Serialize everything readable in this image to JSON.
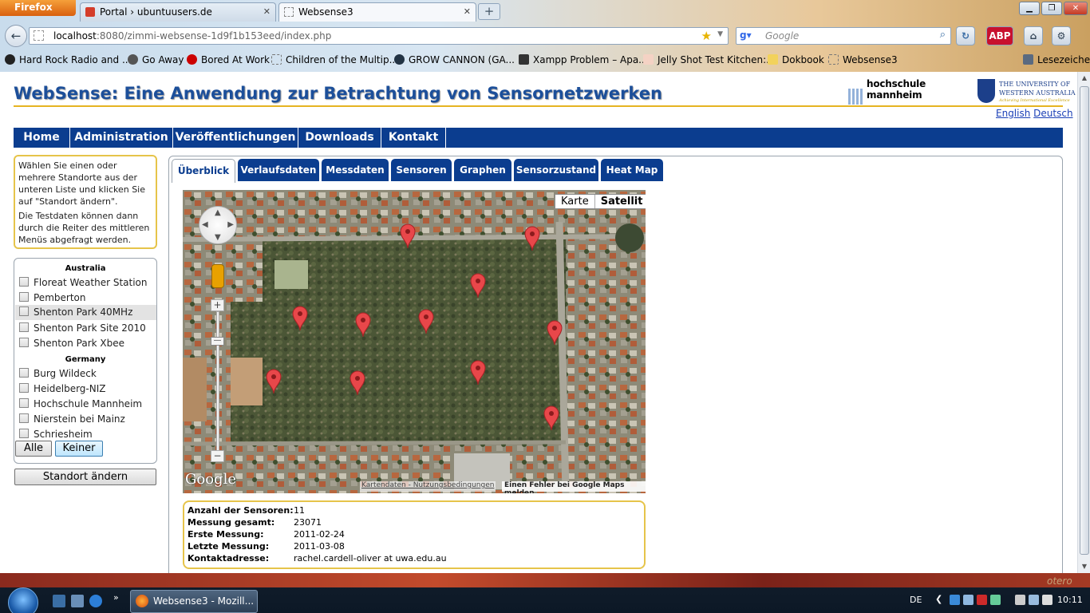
{
  "browser": {
    "app_button": "Firefox",
    "tabs": [
      {
        "label": "Portal › ubuntuusers.de"
      },
      {
        "label": "Websense3"
      }
    ],
    "url_host": "localhost",
    "url_rest": ":8080/zimmi-websense-1d9f1b153eed/index.php",
    "search_placeholder": "Google",
    "bookmarks": [
      "Hard Rock Radio and ...",
      "Go Away",
      "Bored At Work",
      "Children of the Multip...",
      "GROW CANNON (GA...",
      "Xampp Problem – Apa...",
      "Jelly Shot Test Kitchen:...",
      "Dokbook",
      "Websense3",
      "Lesezeichen"
    ]
  },
  "site": {
    "title": "WebSense: Eine Anwendung zur Betrachtung von Sensornetzwerken",
    "hs_logo_text": "hochschule mannheim",
    "uwa_line1": "The University of",
    "uwa_line2": "Western Australia",
    "uwa_tagline": "Achieving International Excellence",
    "lang_en": "English",
    "lang_de": "Deutsch"
  },
  "mainnav": [
    "Home",
    "Administration",
    "Veröffentlichungen",
    "Downloads",
    "Kontakt"
  ],
  "sidebar": {
    "info_p1": "Wählen Sie einen oder mehrere Standorte aus der unteren Liste und klicken Sie auf \"Standort ändern\".",
    "info_p2": "Die Testdaten können dann durch die Reiter des mittleren Menüs abgefragt werden.",
    "groups": [
      {
        "name": "Australia",
        "sites": [
          "Floreat Weather Station",
          "Pemberton",
          "Shenton Park 40MHz",
          "Shenton Park Site 2010",
          "Shenton Park Xbee"
        ]
      },
      {
        "name": "Germany",
        "sites": [
          "Burg Wildeck",
          "Heidelberg-NIZ",
          "Hochschule Mannheim",
          "Nierstein bei Mainz",
          "Schriesheim"
        ]
      }
    ],
    "btn_all": "Alle",
    "btn_none": "Keiner",
    "btn_change": "Standort ändern"
  },
  "content_tabs": [
    "Überblick",
    "Verlaufsdaten",
    "Messdaten",
    "Sensoren",
    "Graphen",
    "Sensorzustand",
    "Heat Map"
  ],
  "map": {
    "btn_map": "Karte",
    "btn_satellite": "Satellit",
    "google": "Google",
    "attribution": "Kartendaten - Nutzungsbedingungen",
    "report": "Einen Fehler bei Google Maps melden",
    "pin_color": "#e8474a"
  },
  "stats": [
    {
      "label": "Anzahl der Sensoren:",
      "value": "11"
    },
    {
      "label": "Messung gesamt:",
      "value": "23071"
    },
    {
      "label": "Erste Messung:",
      "value": "2011-02-24"
    },
    {
      "label": "Letzte Messung:",
      "value": "2011-03-08"
    },
    {
      "label": "Kontaktadresse:",
      "value": "rachel.cardell-oliver at uwa.edu.au"
    }
  ],
  "taskbar": {
    "task_label": "Websense3 - Mozill...",
    "lang": "DE",
    "clock": "10:11",
    "wallpaper_text": "otero"
  }
}
